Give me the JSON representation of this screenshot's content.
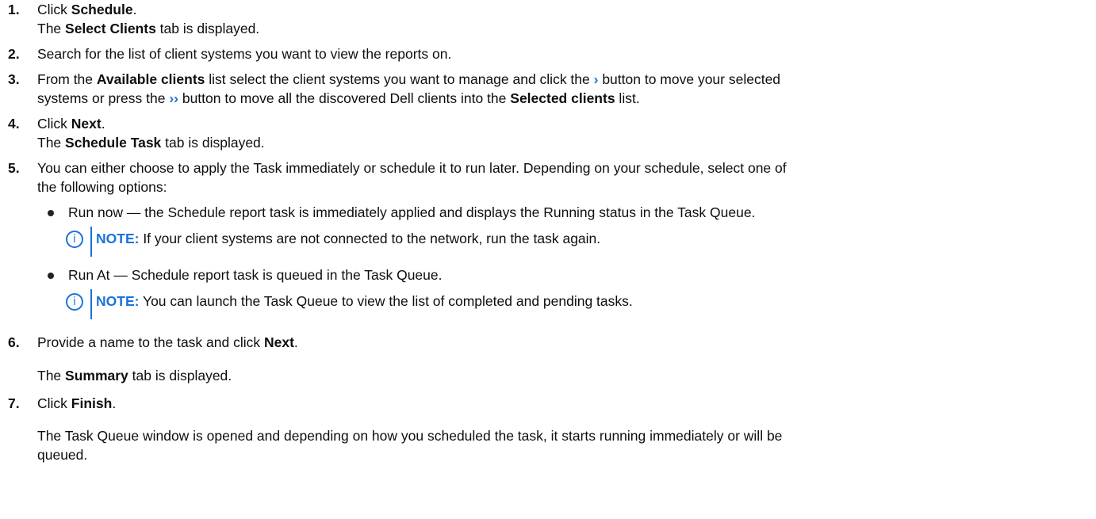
{
  "steps": [
    {
      "number": "1.",
      "line1": {
        "pre": "Click ",
        "bold": "Schedule",
        "post": "."
      },
      "line2": {
        "pre": "The ",
        "bold": "Select Clients",
        "post": " tab is displayed."
      }
    },
    {
      "number": "2.",
      "text": "Search for the list of client systems you want to view the reports on."
    },
    {
      "number": "3.",
      "a": "From the ",
      "b": "Available clients",
      "c": " list select the client systems you want to manage and click the ",
      "chevron_single": "›",
      "d": " button to move your selected",
      "e": "systems or press the ",
      "chevron_double": "››",
      "f": " button to move all the discovered Dell clients into the ",
      "g": "Selected clients",
      "h": " list."
    },
    {
      "number": "4.",
      "line1": {
        "pre": "Click ",
        "bold": "Next",
        "post": "."
      },
      "line2": {
        "pre": "The ",
        "bold": "Schedule Task",
        "post": " tab is displayed."
      }
    },
    {
      "number": "5.",
      "line1": "You can either choose to apply the Task immediately or schedule it to run later. Depending on your schedule, select one of",
      "line2": "the following options:",
      "options": [
        {
          "text": "Run now — the Schedule report task is immediately applied and displays the Running status in the Task Queue.",
          "note_label": "NOTE:",
          "note_text": " If your client systems are not connected to the network, run the task again."
        },
        {
          "text": "Run At — Schedule report task is queued in the Task Queue.",
          "note_label": "NOTE:",
          "note_text": " You can launch the Task Queue to view the list of completed and pending tasks."
        }
      ]
    },
    {
      "number": "6.",
      "line1": {
        "pre": "Provide a name to the task and click ",
        "bold": "Next",
        "post": "."
      },
      "line2": {
        "pre": "The ",
        "bold": "Summary",
        "post": " tab is displayed."
      }
    },
    {
      "number": "7.",
      "line1": {
        "pre": "Click ",
        "bold": "Finish",
        "post": "."
      },
      "line2": "The Task Queue window is opened and depending on how you scheduled the task, it starts running immediately or will be",
      "line3": "queued."
    }
  ],
  "icons": {
    "note_icon_glyph": "i",
    "note_icon": "info-circle-icon",
    "chevron_color": "#1a73d9",
    "accent": "#1a73d9"
  }
}
